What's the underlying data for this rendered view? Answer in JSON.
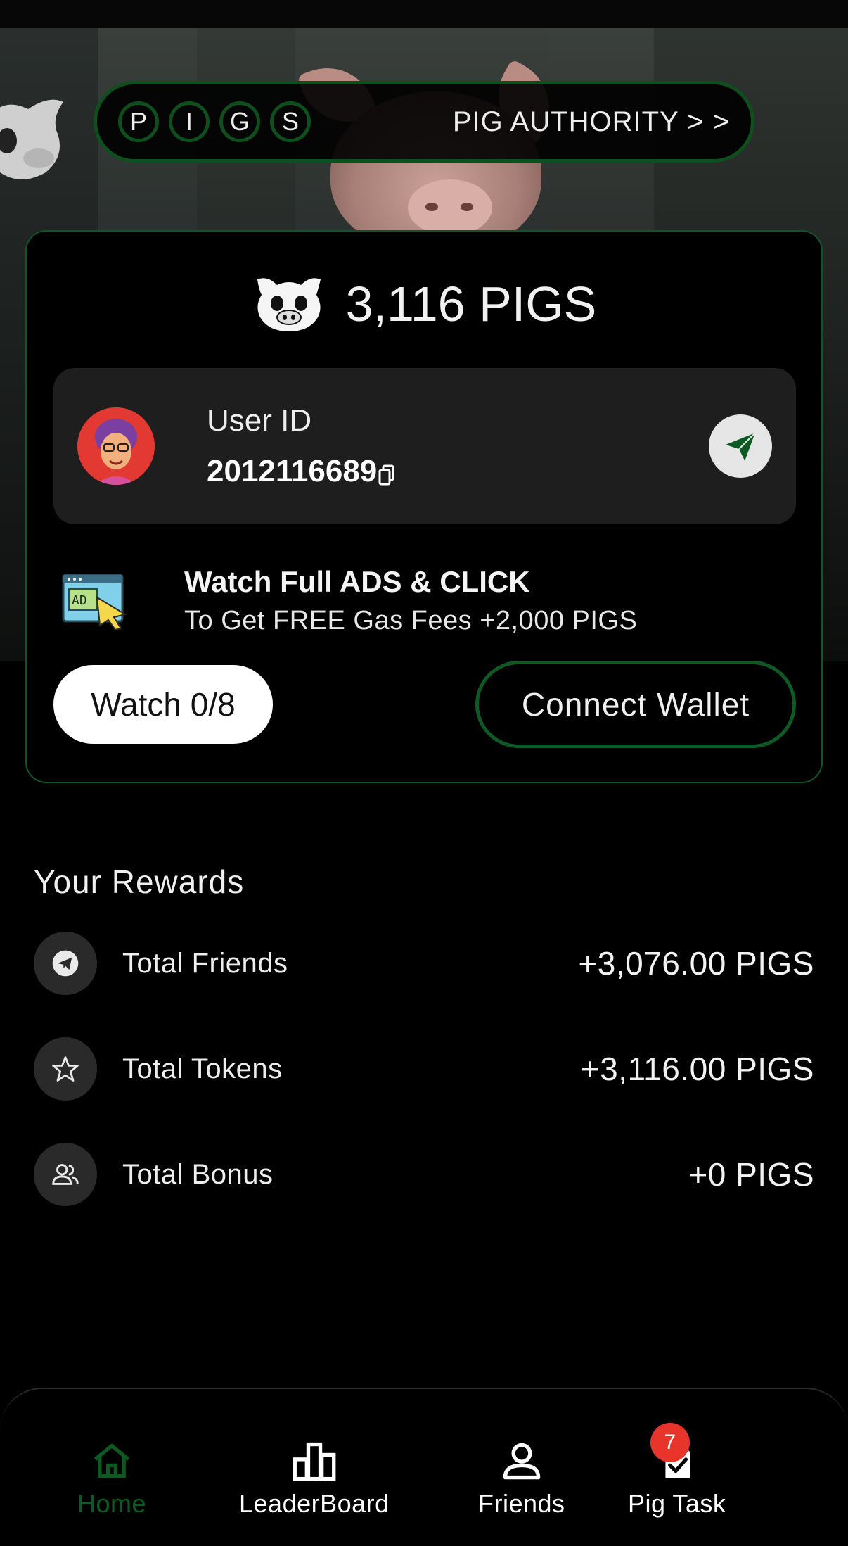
{
  "header": {
    "letters": [
      "P",
      "I",
      "G",
      "S"
    ],
    "authority_link": "PIG AUTHORITY > >"
  },
  "card": {
    "balance": "3,116 PIGS",
    "user_label": "User ID",
    "user_id": "2012116689",
    "ads_title": "Watch Full ADS & CLICK",
    "ads_subtitle": "To Get FREE Gas Fees +2,000 PIGS",
    "ads_icon_text": "AD",
    "watch_button": "Watch 0/8",
    "connect_button": "Connect Wallet"
  },
  "rewards": {
    "title": "Your Rewards",
    "items": [
      {
        "label": "Total Friends",
        "value": "+3,076.00 PIGS",
        "icon": "telegram-icon"
      },
      {
        "label": "Total Tokens",
        "value": "+3,116.00 PIGS",
        "icon": "star-icon"
      },
      {
        "label": "Total Bonus",
        "value": "+0 PIGS",
        "icon": "people-icon"
      }
    ]
  },
  "nav": {
    "items": [
      {
        "label": "Home",
        "icon": "home-icon",
        "active": true
      },
      {
        "label": "LeaderBoard",
        "icon": "leaderboard-icon",
        "active": false
      },
      {
        "label": "Friends",
        "icon": "person-icon",
        "active": false
      },
      {
        "label": "Pig Task",
        "icon": "task-icon",
        "active": false,
        "badge": "7"
      }
    ]
  },
  "colors": {
    "accent_green": "#0f5a24",
    "badge_red": "#e8352c",
    "background": "#000000"
  }
}
